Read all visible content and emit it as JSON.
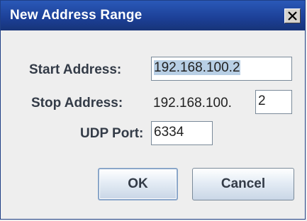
{
  "dialog": {
    "title": "New Address Range",
    "close_label": "X"
  },
  "form": {
    "start_address_label": "Start Address:",
    "start_address_value": "192.168.100.2",
    "stop_address_label": "Stop Address:",
    "stop_address_prefix": "192.168.100.",
    "stop_address_value": "2",
    "udp_port_label": "UDP Port:",
    "udp_port_value": "6334"
  },
  "buttons": {
    "ok_label": "OK",
    "cancel_label": "Cancel"
  },
  "colors": {
    "titlebar": "#1c3f96",
    "title_text": "#ffffff",
    "selection": "#b8cfe5"
  }
}
